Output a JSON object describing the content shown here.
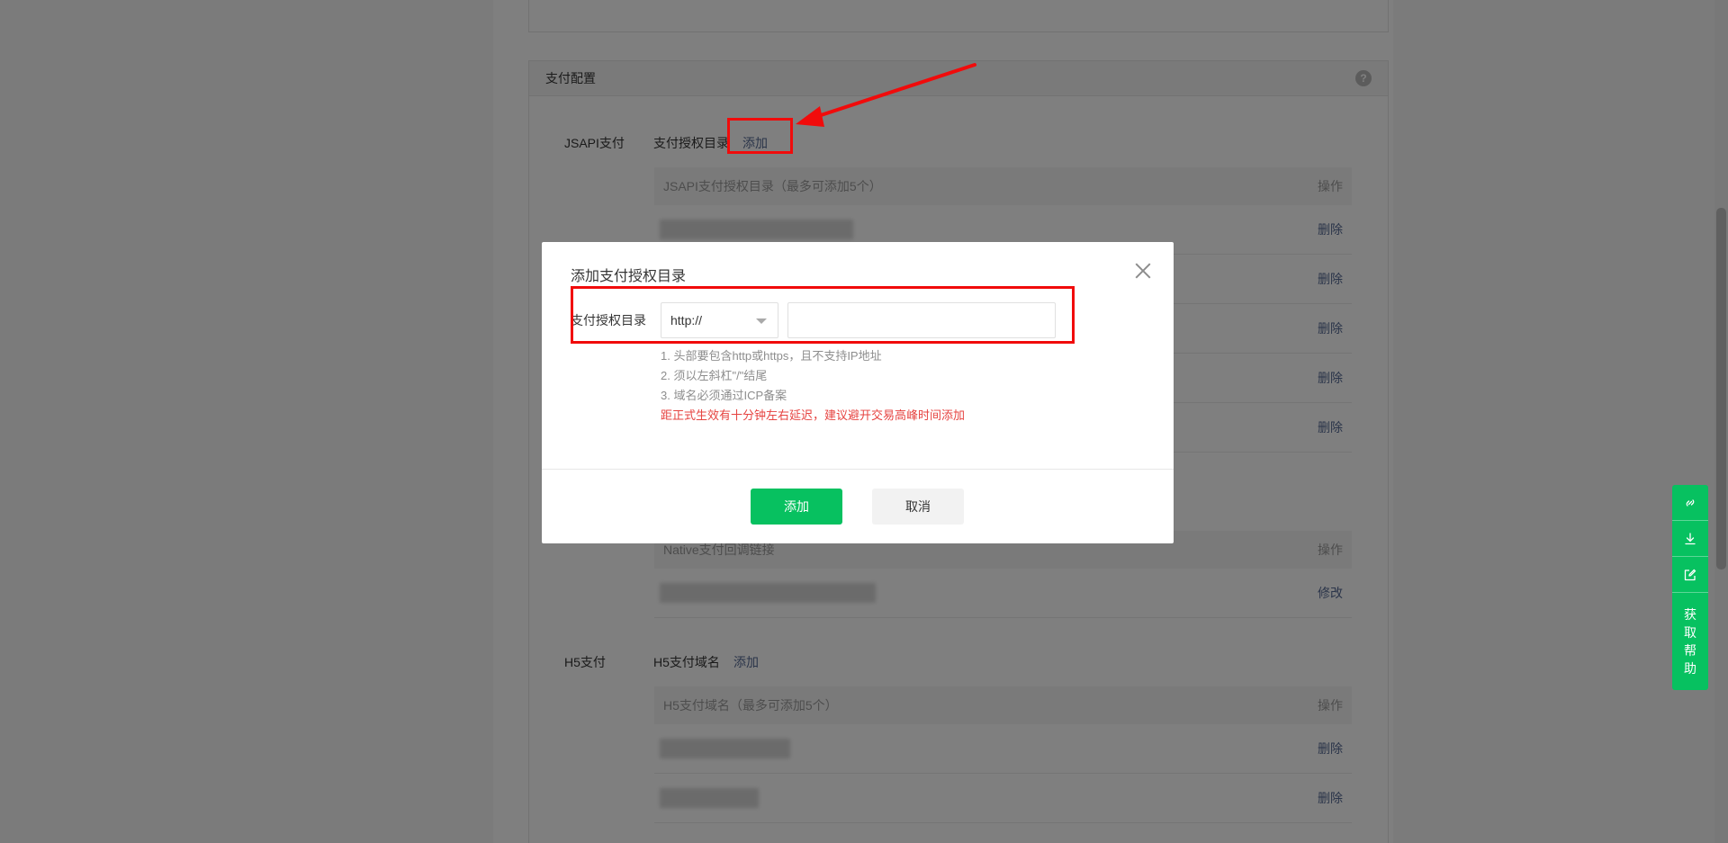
{
  "payment_card": {
    "title": "支付配置",
    "help_icon": "?",
    "jsapi": {
      "label": "JSAPI支付",
      "field_label": "支付授权目录",
      "add_link": "添加",
      "table_header": "JSAPI支付授权目录（最多可添加5个）",
      "table_action_header": "操作",
      "row_action": "删除",
      "rows": 5
    },
    "native": {
      "table_header": "Native支付回调链接",
      "table_action_header": "操作",
      "row_action": "修改"
    },
    "h5": {
      "label": "H5支付",
      "field_label": "H5支付域名",
      "add_link": "添加",
      "table_header": "H5支付域名（最多可添加5个）",
      "table_action_header": "操作",
      "row_action": "删除"
    }
  },
  "dialog": {
    "title": "添加支付授权目录",
    "field_label": "支付授权目录",
    "protocol_selected": "http://",
    "path_input_value": "",
    "tips": [
      "1. 头部要包含http或https，且不支持IP地址",
      "2. 须以左斜杠\"/\"结尾",
      "3. 域名必须通过ICP备案"
    ],
    "warning": "距正式生效有十分钟左右延迟，建议避开交易高峰时间添加",
    "confirm_label": "添加",
    "cancel_label": "取消"
  },
  "side_tools": {
    "help_chars": [
      "获",
      "取",
      "帮",
      "助"
    ]
  },
  "colors": {
    "brand_green": "#07c160",
    "link_blue": "#576b95",
    "warning_red": "#e64340",
    "annotation_red": "#f10b0b"
  }
}
